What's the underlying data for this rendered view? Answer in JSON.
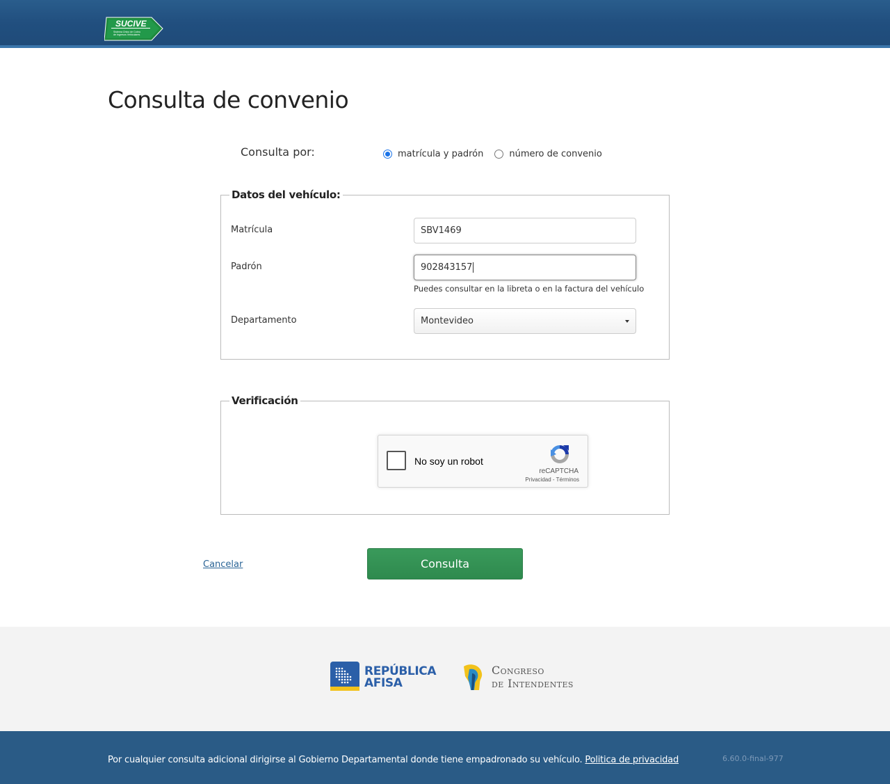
{
  "header": {
    "logo_text": "SUCIVE",
    "logo_subtitle": "Sistema Único de Cobro de Ingresos Vehiculares"
  },
  "page": {
    "title": "Consulta de convenio"
  },
  "query_by": {
    "label": "Consulta por:",
    "options": [
      {
        "label": "matrícula y padrón",
        "checked": true
      },
      {
        "label": "número de convenio",
        "checked": false
      }
    ]
  },
  "vehicle": {
    "legend": "Datos del vehículo:",
    "matricula_label": "Matrícula",
    "matricula_value": "SBV1469",
    "padron_label": "Padrón",
    "padron_value": "902843157",
    "padron_help": "Puedes consultar en la libreta o en la factura del vehículo",
    "departamento_label": "Departamento",
    "departamento_value": "Montevideo"
  },
  "verification": {
    "legend": "Verificación",
    "captcha_label": "No soy un robot",
    "captcha_brand": "reCAPTCHA",
    "captcha_privacy": "Privacidad",
    "captcha_separator": "-",
    "captcha_terms": "Términos"
  },
  "actions": {
    "cancel_label": "Cancelar",
    "submit_label": "Consulta"
  },
  "sponsors": {
    "afisa_line1": "REPÚBLICA",
    "afisa_line2": "AFISA",
    "congreso_line1": "Congreso",
    "congreso_line2": "de Intendentes"
  },
  "footer": {
    "text": "Por cualquier consulta adicional dirigirse al Gobierno Departamental donde tiene empadronado su vehículo.",
    "privacy_link": "Politica de privacidad",
    "version": "6.60.0-final-977"
  },
  "colors": {
    "header_blue": "#214f7f",
    "brand_green": "#2e8a4e",
    "footer_blue": "#2a5b86",
    "radio_blue": "#1a73e8"
  }
}
